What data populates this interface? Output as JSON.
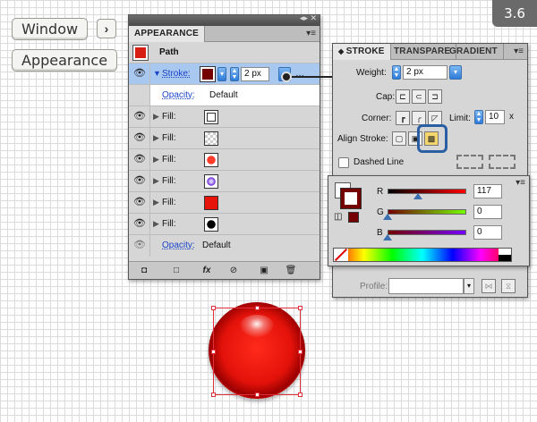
{
  "breadcrumb": {
    "window_label": "Window",
    "arrow": "›",
    "appearance_label": "Appearance"
  },
  "step_badge": "3.6",
  "appearance_panel": {
    "tab": "APPEARANCE",
    "header_title": "Path",
    "stroke_row": {
      "label": "Stroke:",
      "weight": "2 px"
    },
    "opacity_row": {
      "label": "Opacity:",
      "value": "Default"
    },
    "fills": [
      {
        "label": "Fill:",
        "swatch": "white"
      },
      {
        "label": "Fill:",
        "swatch": "transparent"
      },
      {
        "label": "Fill:",
        "swatch": "red-radial"
      },
      {
        "label": "Fill:",
        "swatch": "purple-radial"
      },
      {
        "label": "Fill:",
        "swatch": "red"
      },
      {
        "label": "Fill:",
        "swatch": "black-radial"
      }
    ],
    "bottom_opacity": {
      "label": "Opacity:",
      "value": "Default"
    },
    "bottom_icons": [
      "new-art-icon",
      "clear-icon",
      "fx-icon",
      "no-icon",
      "duplicate-icon",
      "trash-icon"
    ]
  },
  "stroke_panel": {
    "tabs": [
      "STROKE",
      "TRANSPARE",
      "GRADIENT"
    ],
    "weight_label": "Weight:",
    "weight_value": "2 px",
    "cap_label": "Cap:",
    "corner_label": "Corner:",
    "limit_label": "Limit:",
    "limit_value": "10",
    "limit_unit": "x",
    "align_label": "Align Stroke:",
    "dashed_label": "Dashed Line",
    "profile_label": "Profile:"
  },
  "color_panel": {
    "sliders": [
      {
        "label": "R",
        "value": "117"
      },
      {
        "label": "G",
        "value": "0"
      },
      {
        "label": "B",
        "value": "0"
      }
    ]
  },
  "colors": {
    "accent": "#2d7bd9",
    "stroke_color": "#750000",
    "selection": "#e0303a",
    "highlight": "#2a5fa3"
  }
}
